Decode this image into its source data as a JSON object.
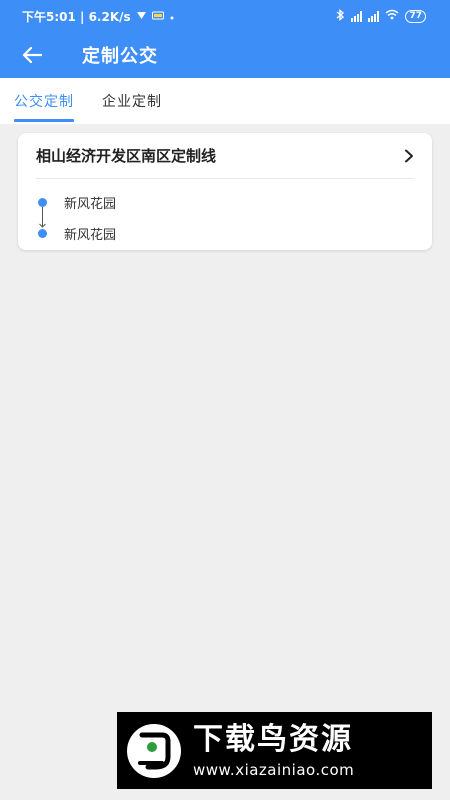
{
  "status_bar": {
    "time_speed": "下午5:01 | 6.2K/s",
    "battery": "77"
  },
  "header": {
    "title": "定制公交"
  },
  "tabs": [
    {
      "label": "公交定制",
      "active": true
    },
    {
      "label": "企业定制",
      "active": false
    }
  ],
  "route_card": {
    "name": "相山经济开发区南区定制线",
    "start_stop": "新风花园",
    "end_stop": "新风花园"
  },
  "watermark": {
    "brand": "下载鸟资源",
    "url": "www.xiazainiao.com"
  },
  "colors": {
    "primary": "#3e8ef7",
    "background": "#efefef"
  }
}
